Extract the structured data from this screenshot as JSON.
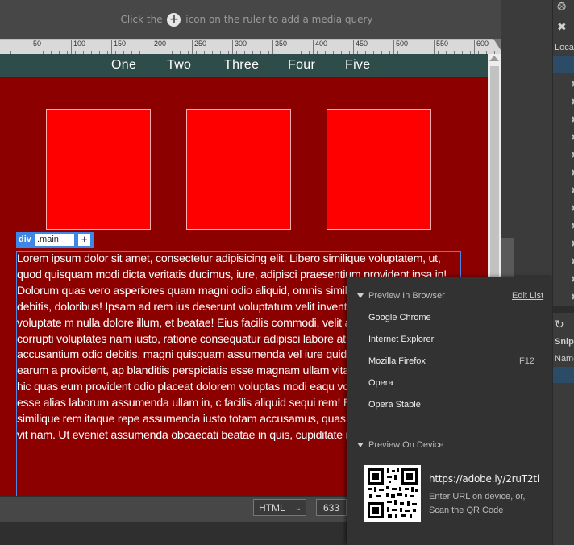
{
  "media_query_bar": {
    "hint_before": "Click the",
    "hint_after": "icon on the ruler to add a media query",
    "ruler_ticks": [
      "50",
      "100",
      "150",
      "200",
      "250",
      "300",
      "350",
      "400",
      "450",
      "500",
      "550",
      "600"
    ]
  },
  "page": {
    "nav": [
      "One",
      "Two",
      "Three",
      "Four",
      "Five"
    ],
    "element_hud": {
      "tag": "div",
      "class": ".main",
      "add": "+"
    },
    "body_text": "Lorem ipsum dolor sit amet, consectetur adipisicing elit. Libero similique voluptatem, ut, quod quisquam modi dicta veritatis ducimus, iure, adipisci praesentium provident ipsa in! Dolorum quas vero asperiores quam magni odio aliquid, omnis similique repellendus debitis, doloribus! Ipsam ad rem ius deserunt voluptatum velit inventore tempore aperiam voluptate m nulla dolore illum, et beatae! Eius facilis commodi, velit at. Repreh enim corrupti voluptates nam iusto, ratione consequatur adipisci labore at earum vitae accusantium odio debitis, magni quisquam assumenda vel iure quidem. Quaerat animi earum a provident, ap blanditiis perspiciatis esse magnam ullam vitae, nam asperiores a hic quas eum provident odio placeat dolorem voluptas modi eaqu voluptates molestias sit esse alias laborum assumenda ullam in, c facilis aliquid sequi rem! Eaque, sit ipsa similique rem itaque repe assumenda iusto totam accusamus, quas, cupiditate provident vit nam. Ut eveniet assumenda obcaecati beatae in quis, cupiditate ir"
  },
  "status_bar": {
    "language": "HTML",
    "dimensions": "633 x"
  },
  "preview_popup": {
    "browser_section": "Preview In Browser",
    "edit_list": "Edit List",
    "browsers": [
      {
        "name": "Google Chrome",
        "shortcut": ""
      },
      {
        "name": "Internet Explorer",
        "shortcut": ""
      },
      {
        "name": "Mozilla Firefox",
        "shortcut": "F12"
      },
      {
        "name": "Opera",
        "shortcut": ""
      },
      {
        "name": "Opera Stable",
        "shortcut": ""
      }
    ],
    "device_section": "Preview On Device",
    "url": "https://adobe.ly/2ruT2ti",
    "hint_line1": "Enter URL on device, or,",
    "hint_line2": "Scan the QR Code"
  },
  "right_panel": {
    "files_label": "Loca",
    "snippets_label": "Snipp",
    "name_label": "Name"
  },
  "colors": {
    "page_background": "#8c0000",
    "nav_background": "#2e4d4a",
    "box_fill": "#ff0000",
    "selection_blue": "#3e87e4"
  }
}
